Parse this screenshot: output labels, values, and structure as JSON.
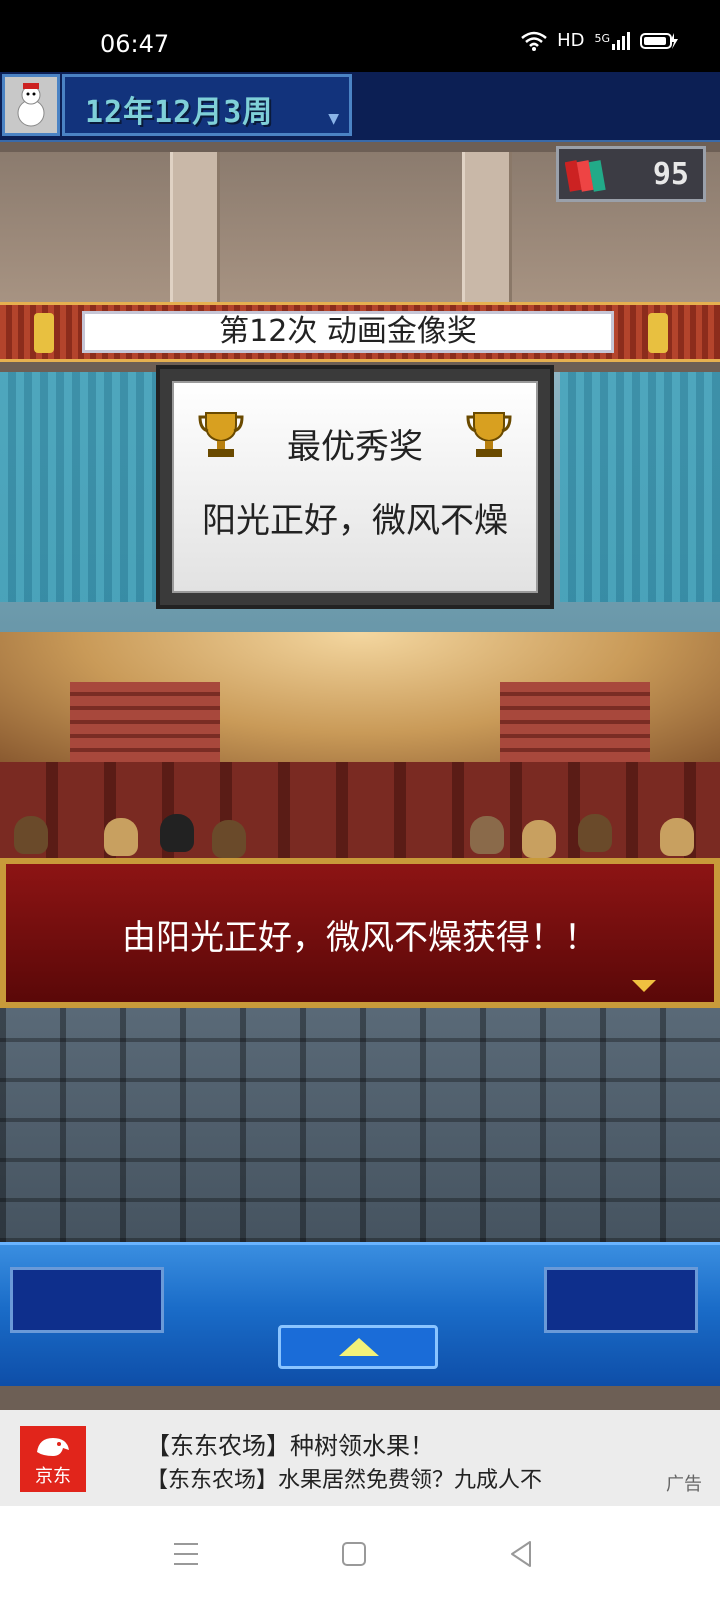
{
  "status_bar": {
    "time": "06:47",
    "network": "HD",
    "signal_label": "5G"
  },
  "game": {
    "date": "12年12月3周",
    "counter": "95",
    "banner_title": "第12次 动画金像奖",
    "award": {
      "name": "最优秀奖",
      "winner": "阳光正好，微风不燥"
    },
    "dialog": "由阳光正好，微风不燥获得！！"
  },
  "ad": {
    "brand": "京东",
    "line1": "【东东农场】种树领水果！",
    "line2": "【东东农场】水果居然免费领？九成人不",
    "tag": "广告"
  },
  "colors": {
    "dialog_bg": "#8d1414",
    "control_bar": "#1a6cc8",
    "ad_brand": "#e1251b"
  }
}
